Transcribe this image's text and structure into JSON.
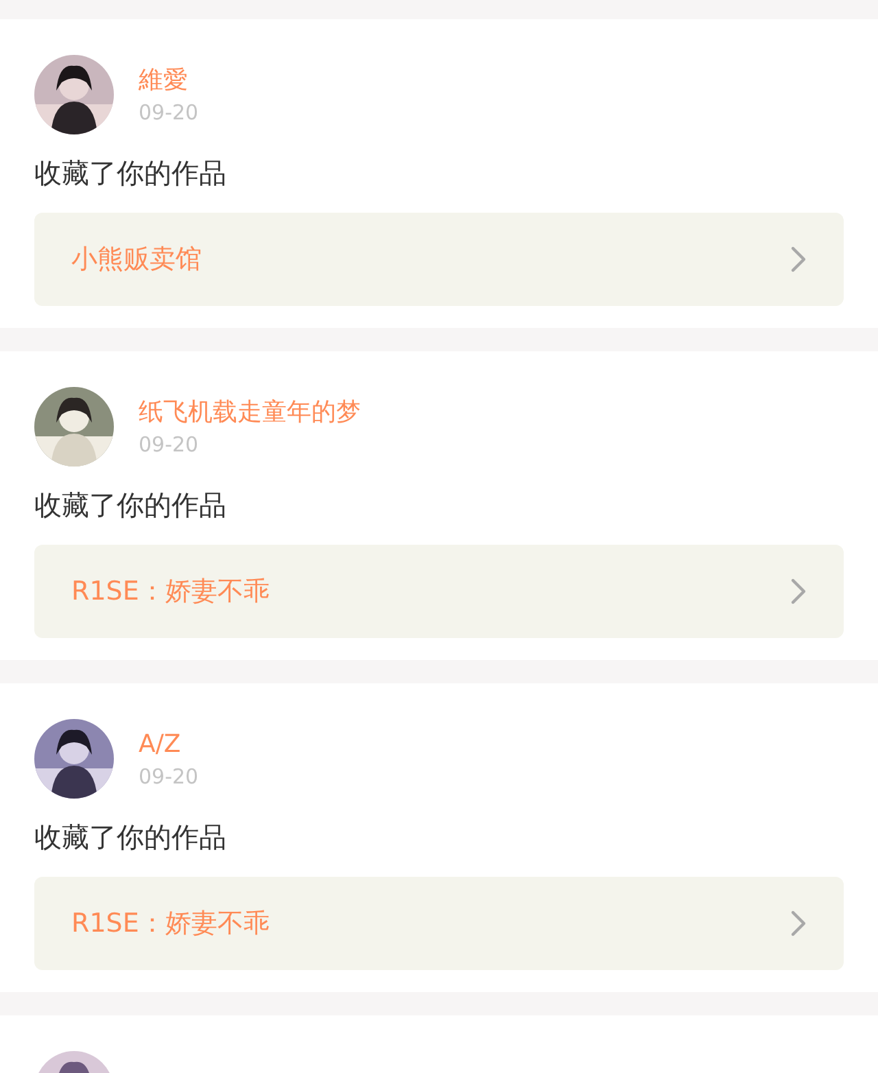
{
  "notifications": [
    {
      "avatar": {
        "kind": "picture"
      },
      "user": "維愛",
      "date": "09-20",
      "action": "收藏了你的作品",
      "work": "小熊贩卖馆"
    },
    {
      "avatar": {
        "kind": "picture"
      },
      "user": "纸飞机载走童年的梦",
      "date": "09-20",
      "action": "收藏了你的作品",
      "work": "R1SE：娇妻不乖"
    },
    {
      "avatar": {
        "kind": "picture"
      },
      "user": "A/Z",
      "date": "09-20",
      "action": "收藏了你的作品",
      "work": "R1SE：娇妻不乖"
    },
    {
      "avatar": {
        "kind": "picture"
      }
    }
  ]
}
